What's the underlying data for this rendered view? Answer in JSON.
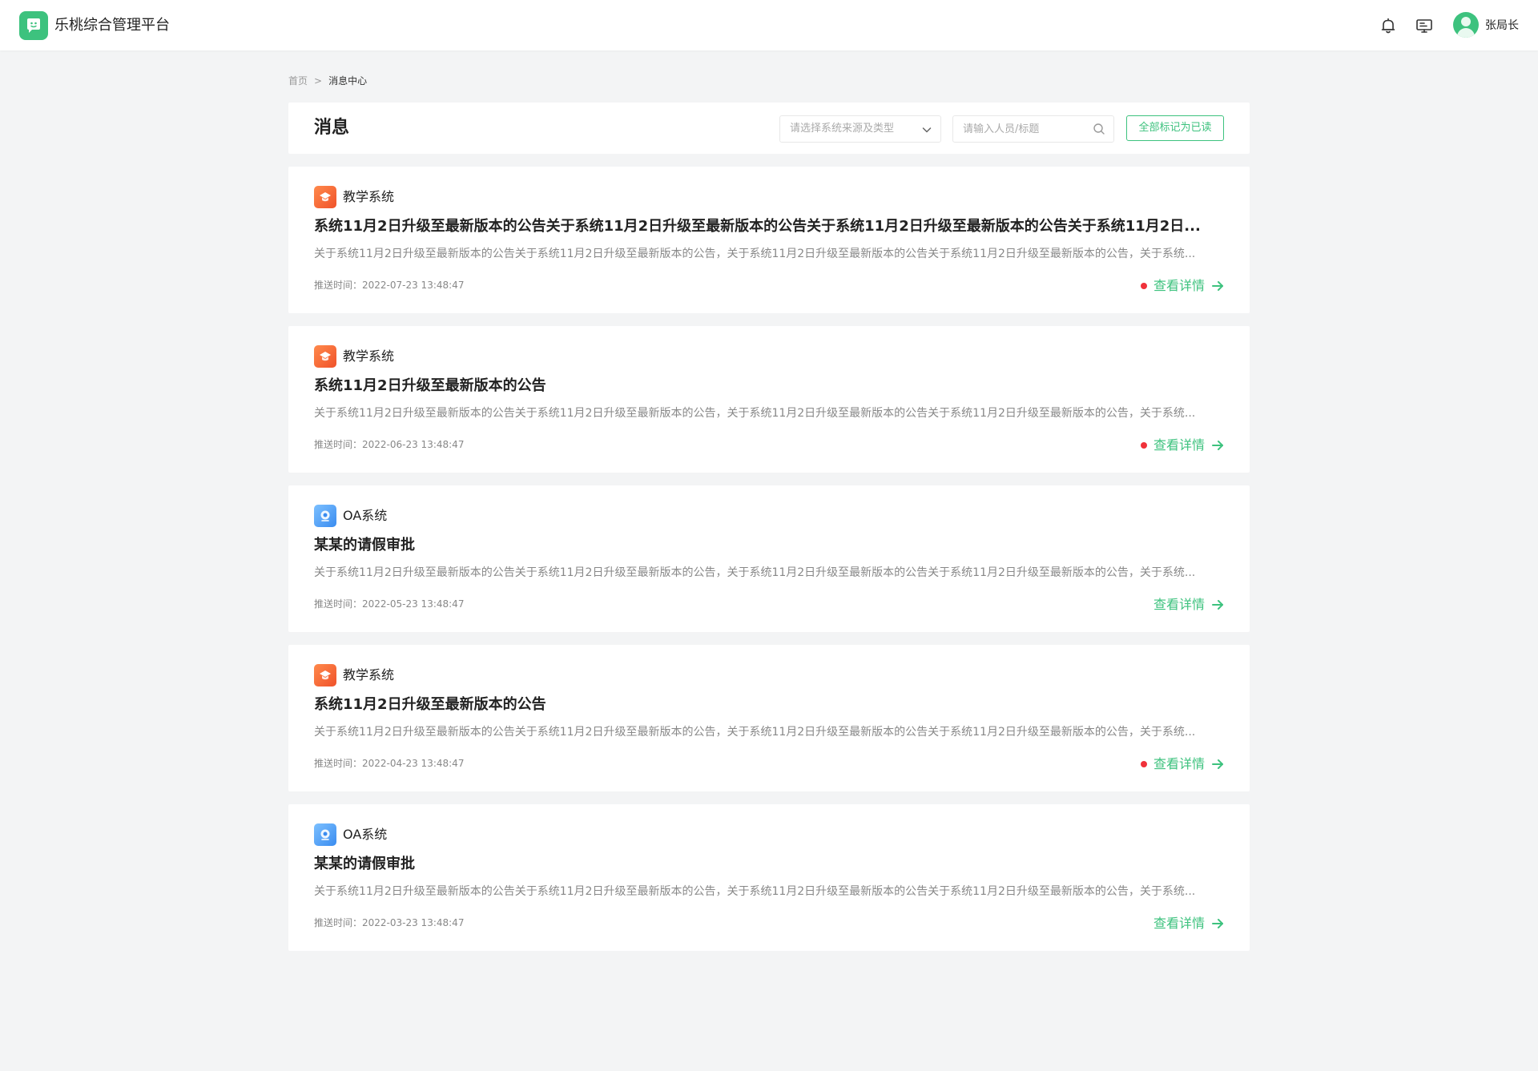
{
  "app": {
    "title": "乐桃综合管理平台",
    "brand_color": "#3dc27e",
    "logo_icon": "chat-bubble-face-icon"
  },
  "header": {
    "username": "张局长",
    "icons": [
      "bell-icon",
      "monitor-icon"
    ]
  },
  "breadcrumb": {
    "home": "首页",
    "separator": ">",
    "current": "消息中心"
  },
  "toolbar": {
    "title": "消息",
    "source_select_placeholder": "请选择系统来源及类型",
    "search_placeholder": "请输入人员/标题",
    "mark_all_read_label": "全部标记为已读"
  },
  "colors": {
    "unread_dot": "#f0313a",
    "link": "#3dc27e",
    "teach_icon": "#f0522a",
    "oa_icon": "#3a8cf0"
  },
  "messages": [
    {
      "source": "教学系统",
      "source_icon": "teaching-system-icon",
      "title": "系统11月2日升级至最新版本的公告关于系统11月2日升级至最新版本的公告关于系统11月2日升级至最新版本的公告关于系统11月2日...",
      "body": "关于系统11月2日升级至最新版本的公告关于系统11月2日升级至最新版本的公告，关于系统11月2日升级至最新版本的公告关于系统11月2日升级至最新版本的公告，关于系统...",
      "time": "推送时间：2022-07-23 13:48:47",
      "unread": true,
      "link_label": "查看详情"
    },
    {
      "source": "教学系统",
      "source_icon": "teaching-system-icon",
      "title": "系统11月2日升级至最新版本的公告",
      "body": "关于系统11月2日升级至最新版本的公告关于系统11月2日升级至最新版本的公告，关于系统11月2日升级至最新版本的公告关于系统11月2日升级至最新版本的公告，关于系统...",
      "time": "推送时间：2022-06-23 13:48:47",
      "unread": true,
      "link_label": "查看详情"
    },
    {
      "source": "OA系统",
      "source_icon": "oa-system-icon",
      "title": "某某的请假审批",
      "body": "关于系统11月2日升级至最新版本的公告关于系统11月2日升级至最新版本的公告，关于系统11月2日升级至最新版本的公告关于系统11月2日升级至最新版本的公告，关于系统...",
      "time": "推送时间：2022-05-23 13:48:47",
      "unread": false,
      "link_label": "查看详情"
    },
    {
      "source": "教学系统",
      "source_icon": "teaching-system-icon",
      "title": "系统11月2日升级至最新版本的公告",
      "body": "关于系统11月2日升级至最新版本的公告关于系统11月2日升级至最新版本的公告，关于系统11月2日升级至最新版本的公告关于系统11月2日升级至最新版本的公告，关于系统...",
      "time": "推送时间：2022-04-23 13:48:47",
      "unread": true,
      "link_label": "查看详情"
    },
    {
      "source": "OA系统",
      "source_icon": "oa-system-icon",
      "title": "某某的请假审批",
      "body": "关于系统11月2日升级至最新版本的公告关于系统11月2日升级至最新版本的公告，关于系统11月2日升级至最新版本的公告关于系统11月2日升级至最新版本的公告，关于系统...",
      "time": "推送时间：2022-03-23 13:48:47",
      "unread": false,
      "link_label": "查看详情"
    }
  ]
}
